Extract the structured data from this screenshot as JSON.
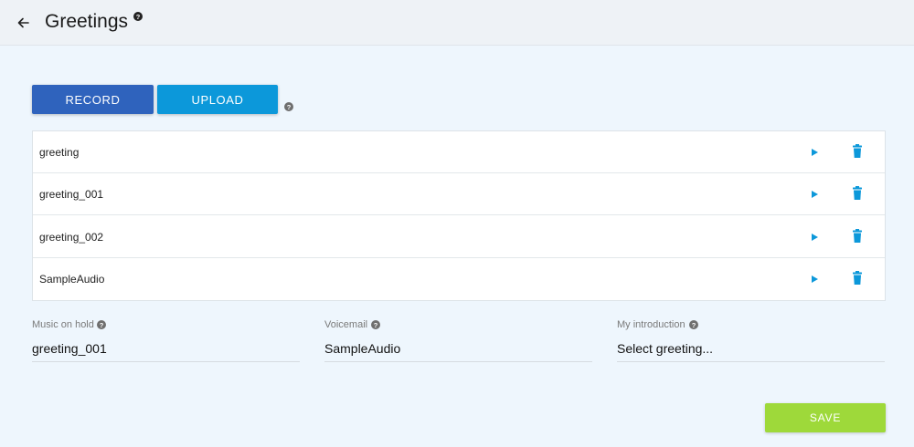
{
  "header": {
    "title": "Greetings",
    "back_icon": "arrow-left-icon",
    "help_icon": "question-circle-icon"
  },
  "actions": {
    "record_label": "RECORD",
    "upload_label": "UPLOAD"
  },
  "greetings": [
    {
      "name": "greeting"
    },
    {
      "name": "greeting_001"
    },
    {
      "name": "greeting_002"
    },
    {
      "name": "SampleAudio"
    }
  ],
  "fields": {
    "music_on_hold": {
      "label": "Music on hold",
      "value": "greeting_001"
    },
    "voicemail": {
      "label": "Voicemail",
      "value": "SampleAudio"
    },
    "my_introduction": {
      "label": "My introduction",
      "value": "Select greeting..."
    }
  },
  "save_label": "SAVE",
  "colors": {
    "record": "#2f63bd",
    "upload": "#0c98da",
    "save": "#9ed93a",
    "icon_blue": "#0c98da",
    "background": "#eef6fd"
  }
}
